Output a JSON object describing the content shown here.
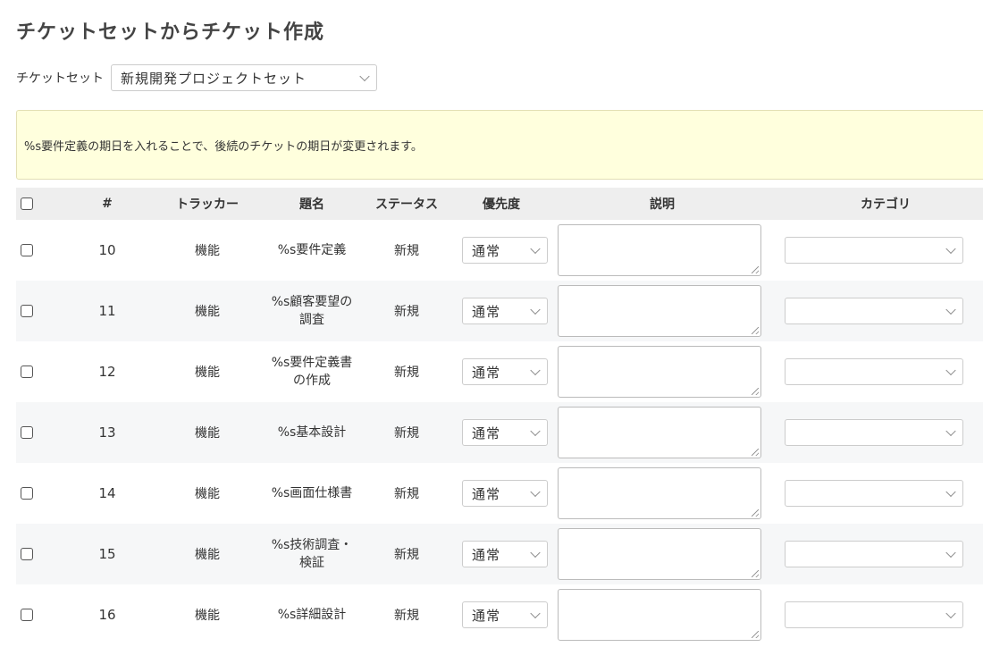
{
  "page": {
    "title": "チケットセットからチケット作成"
  },
  "ticket_set": {
    "label": "チケットセット",
    "selected": "新規開発プロジェクトセット"
  },
  "notice": {
    "text": "%s要件定義の期日を入れることで、後続のチケットの期日が変更されます。"
  },
  "table": {
    "headers": {
      "id": "#",
      "tracker": "トラッカー",
      "subject": "題名",
      "status": "ステータス",
      "priority": "優先度",
      "description": "説明",
      "category": "カテゴリ"
    },
    "rows": [
      {
        "id": "10",
        "tracker": "機能",
        "subject": "%s要件定義",
        "status": "新規",
        "priority": "通常",
        "description": "",
        "category": ""
      },
      {
        "id": "11",
        "tracker": "機能",
        "subject": "%s顧客要望の調査",
        "status": "新規",
        "priority": "通常",
        "description": "",
        "category": ""
      },
      {
        "id": "12",
        "tracker": "機能",
        "subject": "%s要件定義書の作成",
        "status": "新規",
        "priority": "通常",
        "description": "",
        "category": ""
      },
      {
        "id": "13",
        "tracker": "機能",
        "subject": "%s基本設計",
        "status": "新規",
        "priority": "通常",
        "description": "",
        "category": ""
      },
      {
        "id": "14",
        "tracker": "機能",
        "subject": "%s画面仕様書",
        "status": "新規",
        "priority": "通常",
        "description": "",
        "category": ""
      },
      {
        "id": "15",
        "tracker": "機能",
        "subject": "%s技術調査・検証",
        "status": "新規",
        "priority": "通常",
        "description": "",
        "category": ""
      },
      {
        "id": "16",
        "tracker": "機能",
        "subject": "%s詳細設計",
        "status": "新規",
        "priority": "通常",
        "description": "",
        "category": ""
      }
    ]
  },
  "icons": {
    "select_arrow": "chevron-down-icon",
    "resize_handle": "resize-grip-icon"
  },
  "colors": {
    "notice_background": "#ffffdd",
    "header_background": "#eeeeee",
    "alt_row_background": "#f6f7f8"
  }
}
